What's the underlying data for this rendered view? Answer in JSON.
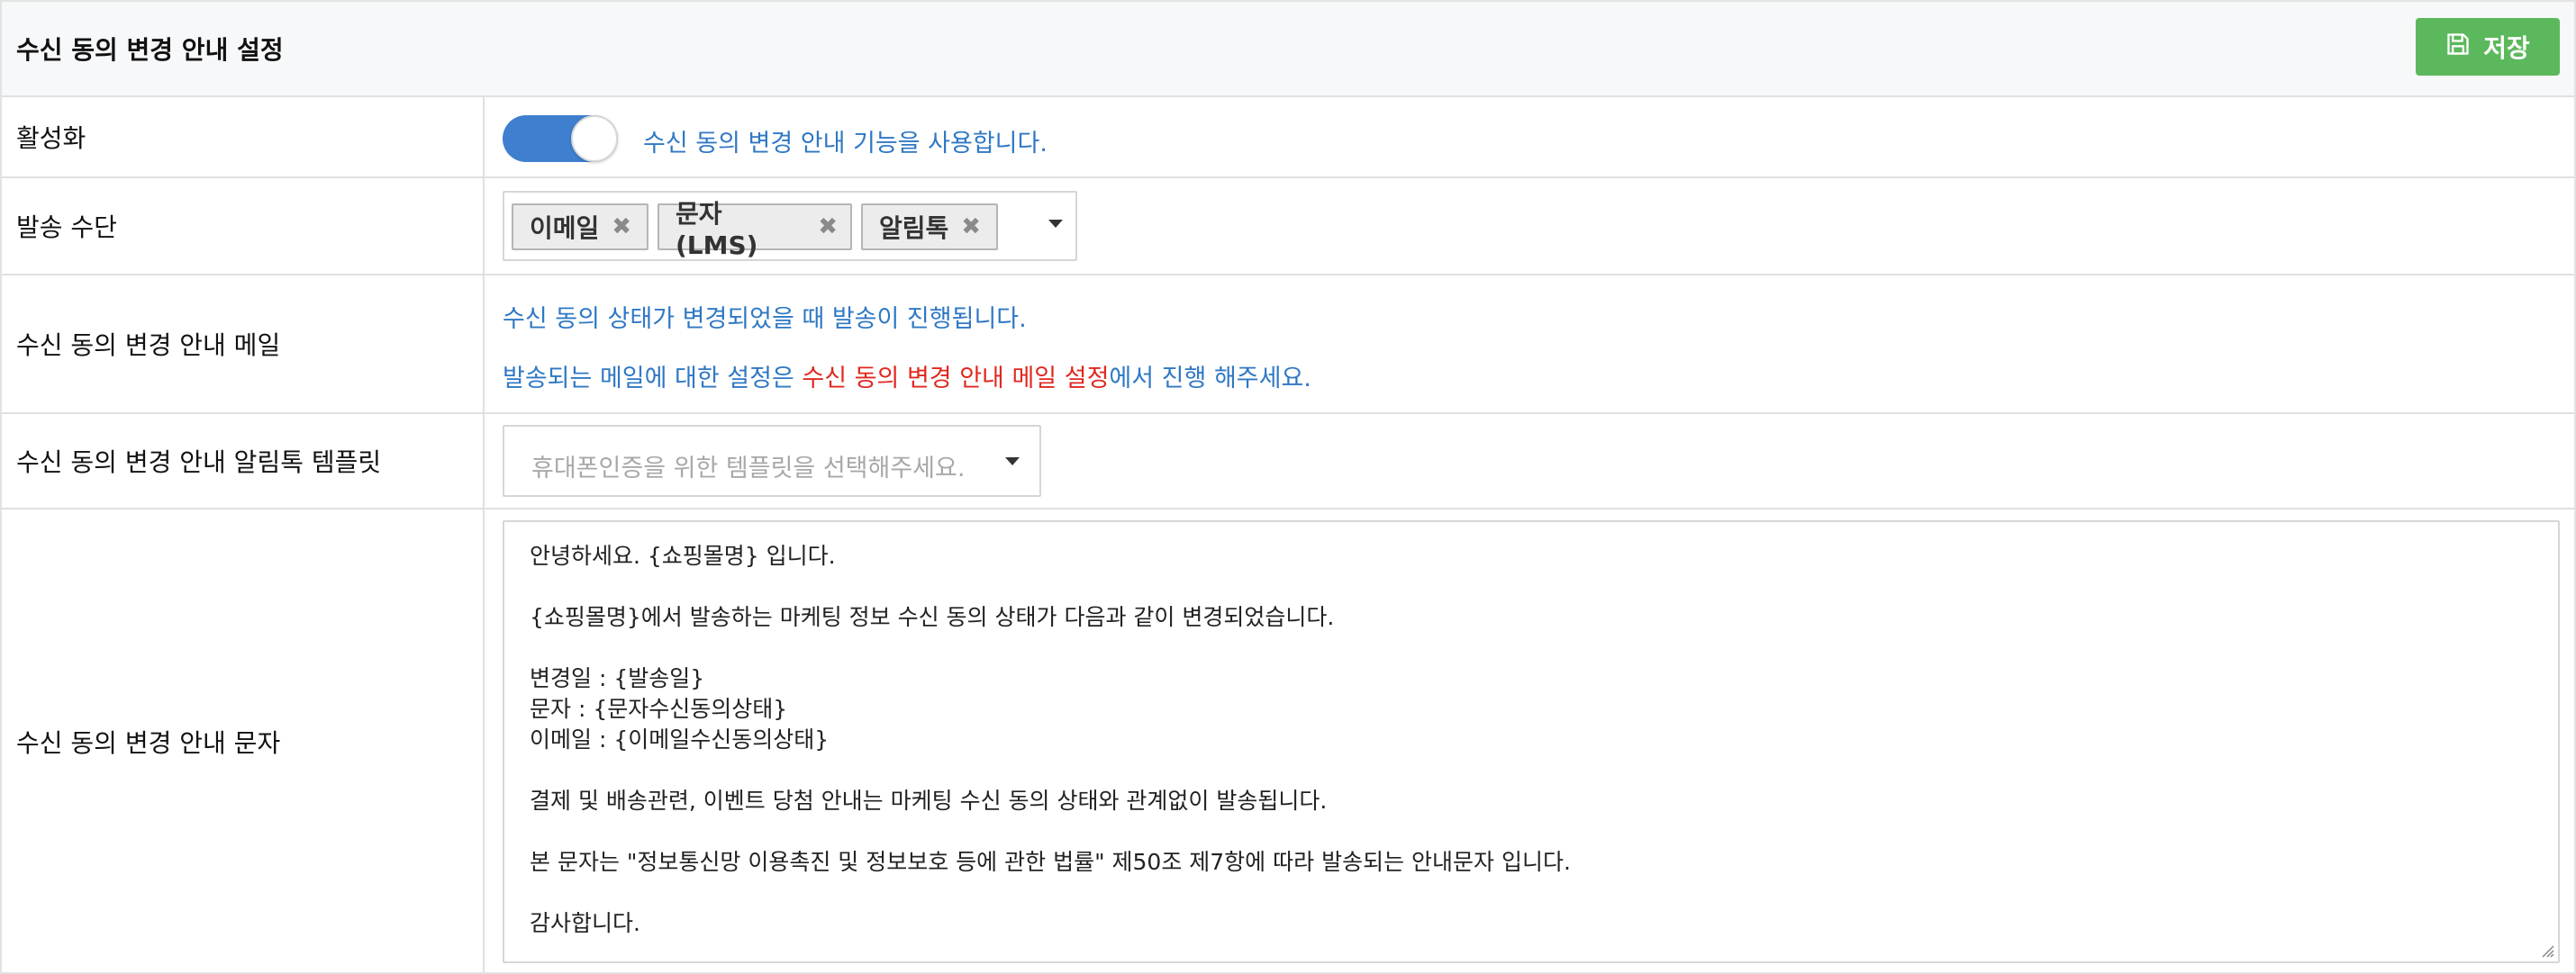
{
  "header": {
    "title": "수신 동의 변경 안내 설정",
    "save_label": "저장",
    "save_icon": "floppy-disk-icon"
  },
  "colors": {
    "accent_blue": "#3f7fcf",
    "link_blue": "#2f78c4",
    "save_green": "#5cb85c",
    "highlight_red": "#e0281f"
  },
  "rows": {
    "activation": {
      "label": "활성화",
      "toggle_on": true,
      "description": "수신 동의 변경 안내 기능을 사용합니다."
    },
    "send_method": {
      "label": "발송 수단",
      "tags": [
        "이메일",
        "문자 (LMS)",
        "알림톡"
      ]
    },
    "mail": {
      "label": "수신 동의 변경 안내 메일",
      "line1": "수신 동의 상태가 변경되었을 때 발송이 진행됩니다.",
      "line2_prefix": "발송되는 메일에 대한 설정은 ",
      "line2_link": "수신 동의 변경 안내 메일 설정",
      "line2_suffix": "에서 진행 해주세요."
    },
    "alimtalk": {
      "label": "수신 동의 변경 안내 알림톡 템플릿",
      "placeholder": "휴대폰인증을 위한 템플릿을 선택해주세요."
    },
    "sms": {
      "label": "수신 동의 변경 안내 문자",
      "lines": [
        "안녕하세요. {쇼핑몰명} 입니다.",
        "",
        "{쇼핑몰명}에서 발송하는 마케팅 정보 수신 동의 상태가 다음과 같이 변경되었습니다.",
        "",
        "변경일 : {발송일}",
        "문자 : {문자수신동의상태}",
        "이메일 : {이메일수신동의상태}",
        "",
        "결제 및 배송관련, 이벤트 당첨 안내는 마케팅 수신 동의 상태와 관계없이 발송됩니다.",
        "",
        "본 문자는 \"정보통신망 이용촉진 및 정보보호 등에 관한 법률\" 제50조 제7항에 따라 발송되는 안내문자 입니다.",
        "",
        "감사합니다."
      ]
    }
  }
}
